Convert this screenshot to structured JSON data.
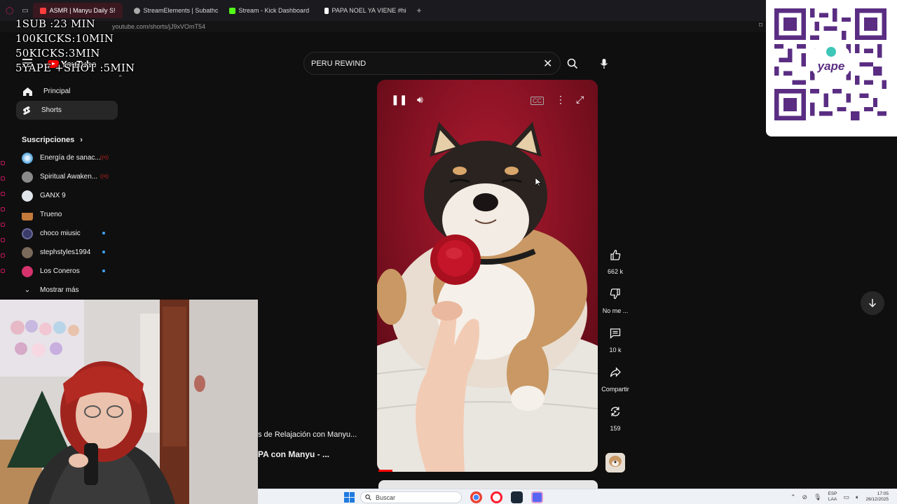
{
  "browser": {
    "tabs": [
      {
        "label": "ASMR | Manyu Daily S!",
        "active": true,
        "fav_color": "#ff3d3d"
      },
      {
        "label": "StreamElements | Subathc",
        "active": false,
        "fav_color": "#aaaaaa"
      },
      {
        "label": "Stream - Kick Dashboard",
        "active": false,
        "fav_color": "#53fc18"
      },
      {
        "label": "PAPA NOEL YA VIENE #hi",
        "active": false,
        "fav_color": "#ffffff"
      }
    ],
    "new_tab": "+",
    "url": "youtube.com/shorts/jJ9xVOmT54"
  },
  "overlay": {
    "lines": [
      "1SUB :23 MIN",
      "100KICKS:10MIN",
      "50KICKS:3MIN",
      "5YAPE +SHOT :5MIN"
    ]
  },
  "youtube": {
    "logo_text": "YouTube",
    "search_value": "PERU REWIND",
    "sidebar": {
      "main": [
        {
          "label": "Principal",
          "icon": "home-icon",
          "active": false
        },
        {
          "label": "Shorts",
          "icon": "shorts-icon",
          "active": true
        }
      ],
      "subs_title": "Suscripciones",
      "subscriptions": [
        {
          "label": "Energía de sanac...",
          "color": "#4a9fd8",
          "live": true,
          "new": false
        },
        {
          "label": "Spiritual Awaken...",
          "color": "#8a8a8a",
          "live": true,
          "new": false
        },
        {
          "label": "GANX 9",
          "color": "#dfe3ea",
          "live": false,
          "new": false
        },
        {
          "label": "Trueno",
          "color": "#c47a3a",
          "live": false,
          "new": false
        },
        {
          "label": "choco miusic",
          "color": "#3b3b6b",
          "live": false,
          "new": true
        },
        {
          "label": "stephstyles1994",
          "color": "#7a6a5a",
          "live": false,
          "new": true
        },
        {
          "label": "Los Coneros",
          "color": "#d6336c",
          "live": false,
          "new": true
        }
      ],
      "show_more": "Mostrar más"
    },
    "actions": [
      {
        "name": "like",
        "label": "662 k"
      },
      {
        "name": "dislike",
        "label": "No me ..."
      },
      {
        "name": "comments",
        "label": "10 k"
      },
      {
        "name": "share",
        "label": "Compartir"
      },
      {
        "name": "remix",
        "label": "159"
      }
    ],
    "partial_title_1": "s de Relajación con Manyu...",
    "partial_title_2": "PA con Manyu - ..."
  },
  "taskbar": {
    "search_placeholder": "Buscar",
    "lang_1": "ESP",
    "lang_2": "LAA",
    "time": "17:05",
    "date": "26/12/2025"
  },
  "colors": {
    "accent": "#ff0000",
    "background": "#0f0f0f",
    "sidebar_active": "#272727"
  }
}
